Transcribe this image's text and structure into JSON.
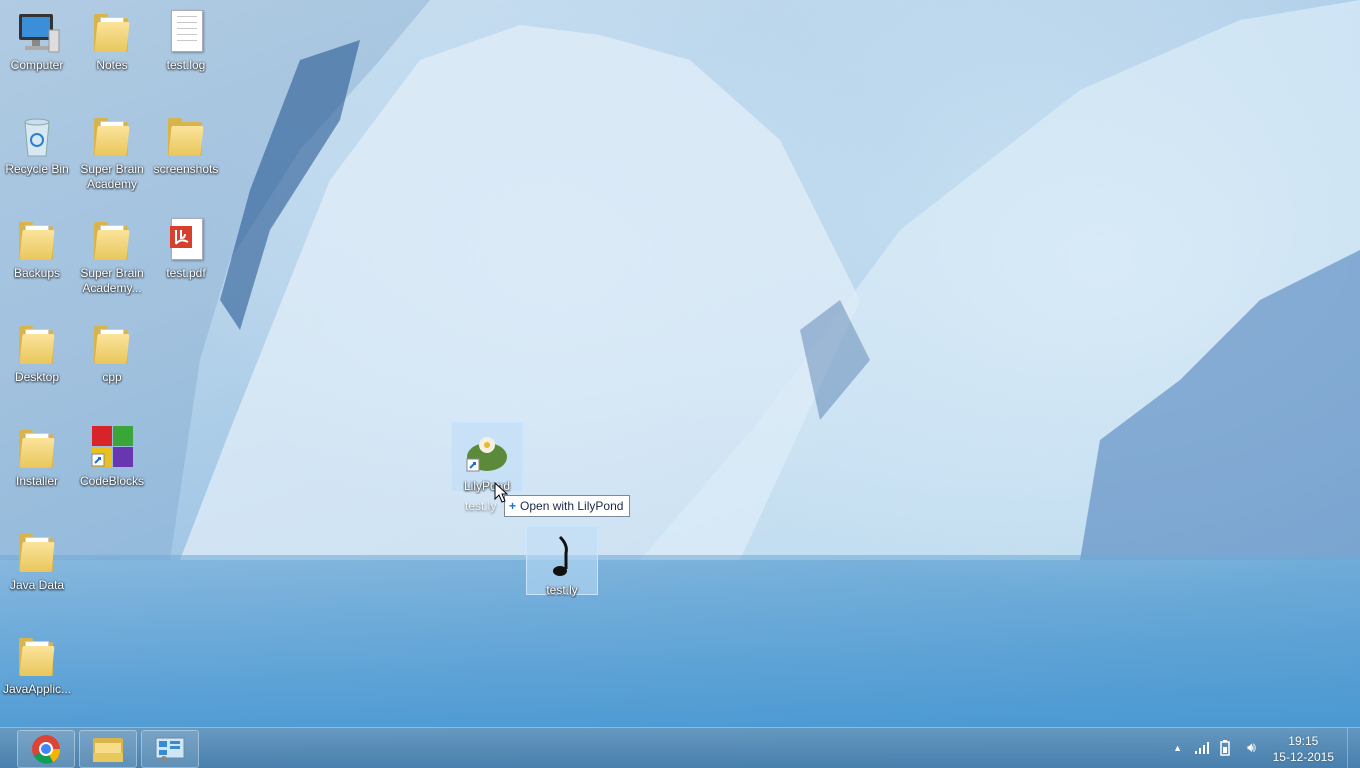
{
  "desktop": {
    "icons": [
      {
        "label": "Computer",
        "icon": "computer-icon"
      },
      {
        "label": "Notes",
        "icon": "folder-icon"
      },
      {
        "label": "test.log",
        "icon": "text-file-icon"
      },
      {
        "label": "Recycle Bin",
        "icon": "recycle-bin-icon"
      },
      {
        "label": "Super Brain Academy",
        "icon": "folder-icon"
      },
      {
        "label": "screenshots",
        "icon": "folder-icon"
      },
      {
        "label": "Backups",
        "icon": "folder-icon"
      },
      {
        "label": "Super Brain Academy...",
        "icon": "folder-icon"
      },
      {
        "label": "test.pdf",
        "icon": "pdf-icon"
      },
      {
        "label": "Desktop",
        "icon": "folder-icon"
      },
      {
        "label": "cpp",
        "icon": "folder-icon"
      },
      {
        "label": "Installer",
        "icon": "folder-icon"
      },
      {
        "label": "CodeBlocks",
        "icon": "codeblocks-icon"
      },
      {
        "label": "Java Data",
        "icon": "folder-icon"
      },
      {
        "label": "JavaApplic...",
        "icon": "folder-icon"
      },
      {
        "label": "LilyPond",
        "icon": "lilypond-shortcut-icon"
      },
      {
        "label": "test.ly",
        "icon": "lilypond-file-icon"
      }
    ],
    "drag_label": "test.ly",
    "tooltip": "Open with LilyPond"
  },
  "taskbar": {
    "buttons": [
      "chrome-icon",
      "file-explorer-icon",
      "control-panel-icon"
    ],
    "time": "19:15",
    "date": "15-12-2015"
  }
}
